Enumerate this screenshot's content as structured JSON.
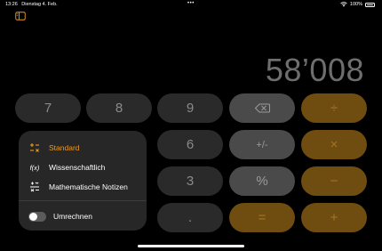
{
  "status_bar": {
    "time": "13:26",
    "date": "Dienstag 4. Feb.",
    "multitask_dots": "•••",
    "battery_text": "100%"
  },
  "display": {
    "value": "58’008"
  },
  "keys": {
    "row1": [
      "7",
      "8",
      "9",
      "⌫",
      "÷"
    ],
    "row2": [
      "6",
      "+/-",
      "×"
    ],
    "row3": [
      "3",
      "%",
      "−"
    ],
    "row4": [
      ".",
      "=",
      "+"
    ]
  },
  "menu": {
    "items": [
      {
        "icon": "±",
        "label": "Standard",
        "selected": true
      },
      {
        "icon": "f(x)",
        "label": "Wissenschaftlich",
        "selected": false
      },
      {
        "icon": "⁒",
        "label": "Mathematische Notizen",
        "selected": false
      }
    ],
    "toggle_label": "Umrechnen",
    "toggle_on": false
  },
  "colors": {
    "accent": "#f09a1a",
    "operator_key": "#6f4d10",
    "digit_key": "#2a2a2a",
    "function_key": "#4a4a4a"
  }
}
